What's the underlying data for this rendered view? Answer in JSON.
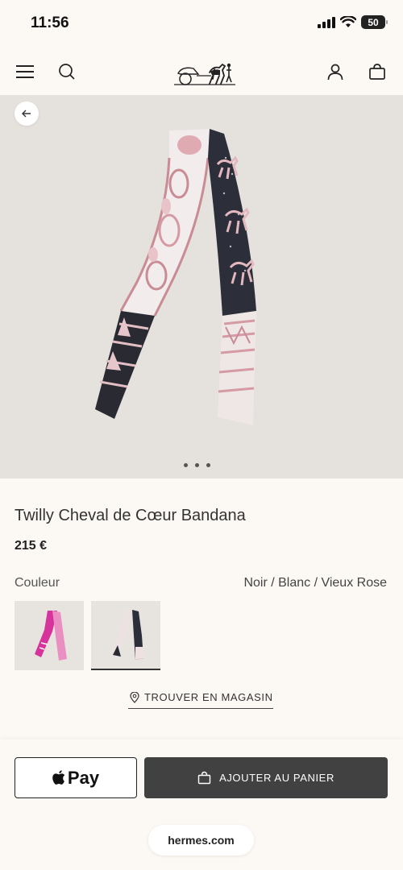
{
  "status": {
    "time": "11:56",
    "battery": "50"
  },
  "header": {
    "menu_icon": "hamburger-icon",
    "search_icon": "search-icon",
    "logo_icon": "horse-carriage-logo",
    "account_icon": "user-icon",
    "bag_icon": "shopping-bag-icon"
  },
  "gallery": {
    "back_icon": "arrow-left-icon",
    "dot_count": 3
  },
  "product": {
    "title": "Twilly Cheval de Cœur Bandana",
    "price": "215 €",
    "color_label": "Couleur",
    "color_value": "Noir / Blanc / Vieux Rose"
  },
  "swatches": [
    {
      "name": "pink",
      "selected": false
    },
    {
      "name": "noir-blanc-vieux-rose",
      "selected": true
    }
  ],
  "store": {
    "label": "TROUVER EN MAGASIN",
    "icon": "location-pin-icon"
  },
  "actions": {
    "pay_label": "Pay",
    "cart_label": "AJOUTER AU PANIER"
  },
  "browser": {
    "url": "hermes.com"
  }
}
